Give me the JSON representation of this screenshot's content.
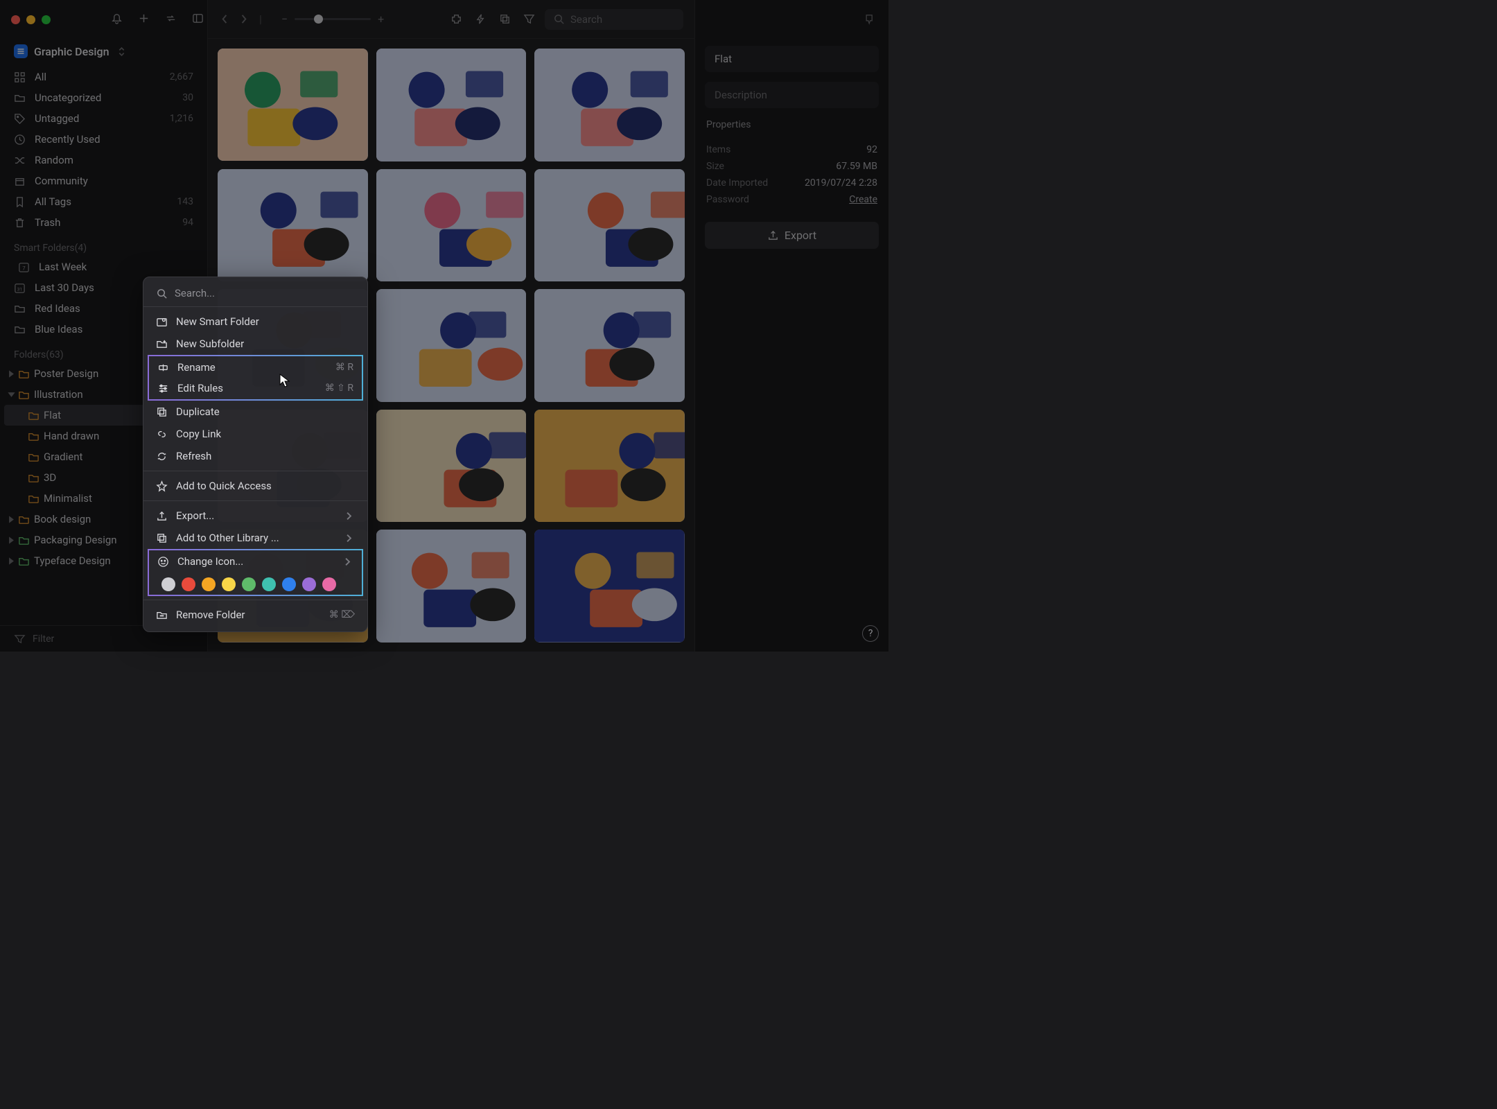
{
  "library": {
    "name": "Graphic Design"
  },
  "sidebar": {
    "items": [
      {
        "label": "All",
        "count": "2,667",
        "icon": "grid"
      },
      {
        "label": "Uncategorized",
        "count": "30",
        "icon": "folder"
      },
      {
        "label": "Untagged",
        "count": "1,216",
        "icon": "tag"
      },
      {
        "label": "Recently Used",
        "count": "",
        "icon": "clock"
      },
      {
        "label": "Random",
        "count": "",
        "icon": "shuffle"
      },
      {
        "label": "Community",
        "count": "",
        "icon": "box"
      },
      {
        "label": "All Tags",
        "count": "143",
        "icon": "bookmark"
      },
      {
        "label": "Trash",
        "count": "94",
        "icon": "trash"
      }
    ],
    "smart_label": "Smart Folders(4)",
    "smart": [
      {
        "label": "Last Week",
        "icon": "cal7"
      },
      {
        "label": "Last 30 Days",
        "icon": "cal31"
      },
      {
        "label": "Red Ideas",
        "icon": "folder"
      },
      {
        "label": "Blue Ideas",
        "icon": "folder"
      }
    ],
    "folders_label": "Folders(63)",
    "folders": [
      {
        "label": "Poster Design",
        "color": "orange",
        "level": 1,
        "disclose": true
      },
      {
        "label": "Illustration",
        "color": "orange",
        "level": 1,
        "disclose": true,
        "open": true
      },
      {
        "label": "Flat",
        "color": "orange",
        "level": 2,
        "selected": true
      },
      {
        "label": "Hand drawn",
        "color": "orange",
        "level": 2
      },
      {
        "label": "Gradient",
        "color": "orange",
        "level": 2
      },
      {
        "label": "3D",
        "color": "orange",
        "level": 2
      },
      {
        "label": "Minimalist",
        "color": "orange",
        "level": 2
      },
      {
        "label": "Book design",
        "color": "orange",
        "level": 1,
        "disclose": true
      },
      {
        "label": "Packaging Design",
        "color": "green",
        "level": 1,
        "disclose": true
      },
      {
        "label": "Typeface Design",
        "color": "green",
        "level": 1,
        "disclose": true
      }
    ],
    "filter_label": "Filter"
  },
  "toolbar": {
    "search_placeholder": "Search"
  },
  "inspector": {
    "title": "Flat",
    "description_placeholder": "Description",
    "properties_label": "Properties",
    "props": [
      {
        "k": "Items",
        "v": "92"
      },
      {
        "k": "Size",
        "v": "67.59 MB"
      },
      {
        "k": "Date Imported",
        "v": "2019/07/24 2:28"
      },
      {
        "k": "Password",
        "v": "Create",
        "link": true
      }
    ],
    "export_label": "Export"
  },
  "context_menu": {
    "search_placeholder": "Search...",
    "items_a": [
      {
        "label": "New Smart Folder",
        "icon": "smartfolder"
      },
      {
        "label": "New Subfolder",
        "icon": "newfolder"
      }
    ],
    "hl1": [
      {
        "label": "Rename",
        "shortcut": "⌘ R",
        "icon": "rename"
      },
      {
        "label": "Edit Rules",
        "shortcut": "⌘ ⇧ R",
        "icon": "rules"
      }
    ],
    "items_b": [
      {
        "label": "Duplicate",
        "icon": "duplicate"
      },
      {
        "label": "Copy Link",
        "icon": "link"
      },
      {
        "label": "Refresh",
        "icon": "refresh"
      }
    ],
    "items_c": [
      {
        "label": "Add to Quick Access",
        "icon": "star"
      }
    ],
    "items_d": [
      {
        "label": "Export...",
        "icon": "export",
        "sub": true
      },
      {
        "label": "Add to Other Library ...",
        "icon": "addlib",
        "sub": true
      }
    ],
    "hl2": [
      {
        "label": "Change Icon...",
        "icon": "smiley",
        "sub": true
      }
    ],
    "colors": [
      "#cfcfd4",
      "#e94b3c",
      "#f5a623",
      "#f8d648",
      "#5fbb6a",
      "#3fc1b0",
      "#2f80ed",
      "#9b6dd7",
      "#e86aa6"
    ],
    "items_e": [
      {
        "label": "Remove Folder",
        "shortcut": "⌘ ⌦",
        "icon": "removefolder"
      }
    ]
  }
}
